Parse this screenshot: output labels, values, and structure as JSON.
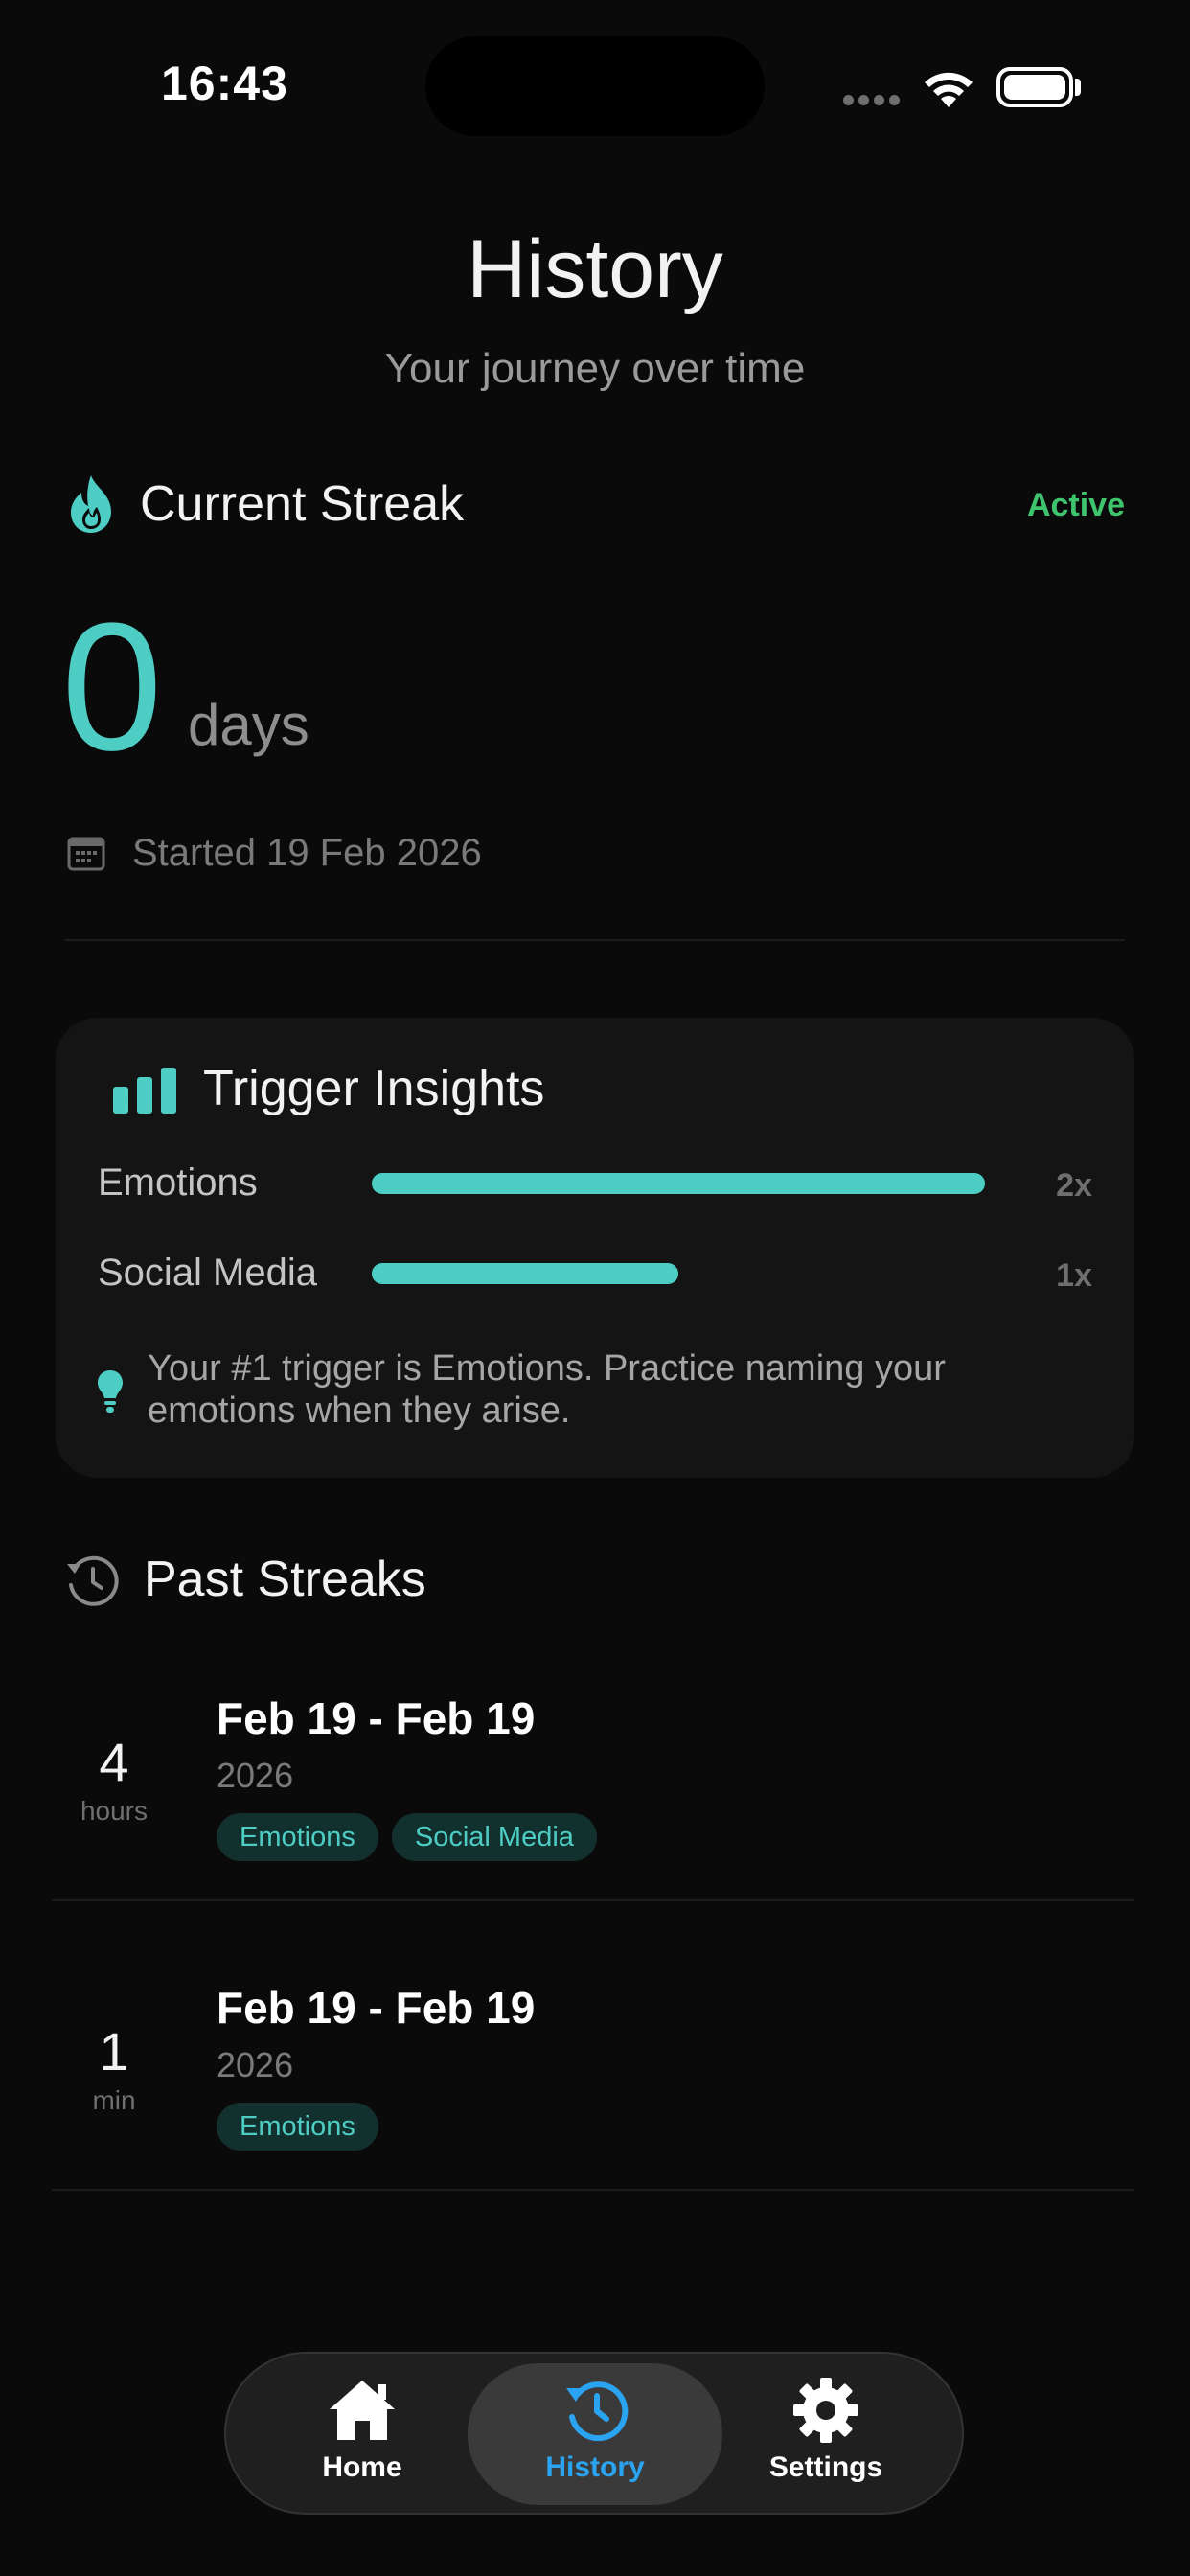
{
  "status_bar": {
    "time": "16:43"
  },
  "header": {
    "title": "History",
    "subtitle": "Your journey over time"
  },
  "current_streak": {
    "title": "Current Streak",
    "status": "Active",
    "count": "0",
    "unit": "days",
    "started": "Started 19 Feb 2026",
    "icon": "flame-icon",
    "accent_color": "#4ecdc4",
    "status_color": "#3ec46d"
  },
  "trigger_insights": {
    "title": "Trigger Insights",
    "triggers": [
      {
        "label": "Emotions",
        "count": "2x",
        "fraction": 1.0
      },
      {
        "label": "Social Media",
        "count": "1x",
        "fraction": 0.5
      }
    ],
    "tip": "Your #1 trigger is Emotions. Practice naming your emotions when they arise."
  },
  "past_streaks": {
    "title": "Past Streaks",
    "items": [
      {
        "value": "4",
        "unit": "hours",
        "dates": "Feb 19 - Feb 19",
        "year": "2026",
        "tags": [
          "Emotions",
          "Social Media"
        ]
      },
      {
        "value": "1",
        "unit": "min",
        "dates": "Feb 19 - Feb 19",
        "year": "2026",
        "tags": [
          "Emotions"
        ]
      }
    ]
  },
  "tab_bar": {
    "tabs": [
      {
        "label": "Home",
        "icon": "home-icon",
        "active": false
      },
      {
        "label": "History",
        "icon": "history-icon",
        "active": true
      },
      {
        "label": "Settings",
        "icon": "gear-icon",
        "active": false
      }
    ],
    "active_color": "#2aa3f0"
  }
}
